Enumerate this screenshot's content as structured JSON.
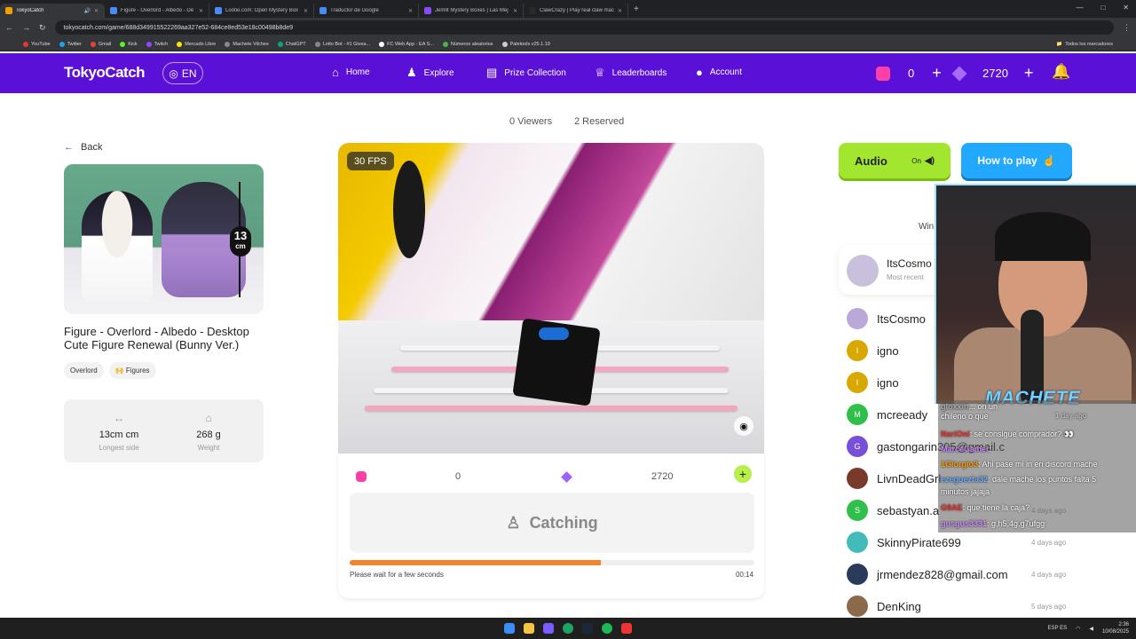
{
  "browser": {
    "tabs": [
      {
        "title": "TokyoCatch",
        "active": true
      },
      {
        "title": "Figure - Overlord - Albedo - De"
      },
      {
        "title": "Lootie.com: Open Mystery Box"
      },
      {
        "title": "Traductor de Google"
      },
      {
        "title": "Jemlit Mystery Boxes | Las Mej"
      },
      {
        "title": "ClawCrazy | Play real claw mac"
      }
    ],
    "url": "tokyocatch.com/game/688d349915522269aa327e52-684ce8ed53e18c00498b8de9",
    "bookmarks": [
      "YouTube",
      "Twitter",
      "Gmail",
      "Kick",
      "Twitch",
      "Mercado Libre",
      "Machete Vilches",
      "ChatGPT",
      "Lotto Bot - #1 Givea...",
      "FC Web App - EA S...",
      "Números aleatorios",
      "Paletools v25.1.19"
    ],
    "bookmarks_right": "Todos los marcadores"
  },
  "header": {
    "logo": "TokyoCatch",
    "lang": "EN",
    "nav": [
      {
        "label": "Home",
        "icon": "home-icon"
      },
      {
        "label": "Explore",
        "icon": "explore-icon"
      },
      {
        "label": "Prize Collection",
        "icon": "prize-collection-icon"
      },
      {
        "label": "Leaderboards",
        "icon": "leaderboard-icon"
      },
      {
        "label": "Account",
        "icon": "account-icon"
      }
    ],
    "tickets": "0",
    "points": "2720"
  },
  "stats": {
    "viewers": "0 Viewers",
    "reserved": "2 Reserved"
  },
  "product": {
    "back_label": "Back",
    "size_tag": "13",
    "size_unit": "cm",
    "title": "Figure - Overlord - Albedo - Desktop Cute Figure Renewal (Bunny Ver.)",
    "tags": [
      "Overlord",
      "🙌 Figures"
    ],
    "specs": [
      {
        "value": "13cm cm",
        "label": "Longest side"
      },
      {
        "value": "268 g",
        "label": "Weight"
      }
    ]
  },
  "game": {
    "fps": "30 FPS",
    "tickets": "0",
    "points": "2720",
    "catch_label": "Catching",
    "progress": 0.62,
    "wait_text": "Please wait for a few seconds",
    "timer": "00:14"
  },
  "right": {
    "audio_label": "Audio",
    "audio_state": "On",
    "howto_label": "How to play",
    "winners_label": "Win",
    "recent": {
      "name": "ItsCosmo",
      "sub": "Most recent"
    },
    "winners": [
      {
        "name": "ItsCosmo",
        "ago": "",
        "initial": "",
        "color": "#b9a8d8"
      },
      {
        "name": "igno",
        "ago": "",
        "initial": "I",
        "color": "#d8a800"
      },
      {
        "name": "igno",
        "ago": "",
        "initial": "I",
        "color": "#d8a800"
      },
      {
        "name": "mcreeady",
        "ago": "",
        "initial": "M",
        "color": "#2fbf4a"
      },
      {
        "name": "gastongarin305@gmail.c",
        "ago": "",
        "initial": "G",
        "color": "#7a4fd8"
      },
      {
        "name": "LivnDeadGrl",
        "ago": "",
        "initial": "",
        "color": "#7a3a2a"
      },
      {
        "name": "sebastyan.a",
        "ago": "4 days ago",
        "initial": "S",
        "color": "#2fbf4a"
      },
      {
        "name": "SkinnyPirate699",
        "ago": "4 days ago",
        "initial": "",
        "color": "#4bb"
      },
      {
        "name": "jrmendez828@gmail.com",
        "ago": "4 days ago",
        "initial": "",
        "color": "#2a3a5a"
      },
      {
        "name": "DenKing",
        "ago": "5 days ago",
        "initial": "",
        "color": "#8a6a4a"
      }
    ]
  },
  "stream": {
    "name": "MACHETE",
    "chat": [
      {
        "user": "gloxxin",
        "text": "... on un",
        "color": "#aaa"
      },
      {
        "user": "",
        "text": "chileno o que",
        "color": "#fff"
      },
      {
        "user": "NariOnl",
        "text": ": se consigue comprador? 👀",
        "color": "#e33"
      },
      {
        "user": "MarceGamer",
        "text": ":",
        "color": "#c8f"
      },
      {
        "user": "1Giorgio3",
        "text": ": Ahi pase mi in en discord mache",
        "color": "#f90"
      },
      {
        "user": "ezeguezta32",
        "text": ": dale mache los puntos falta 5",
        "color": "#6af"
      },
      {
        "user": "",
        "text": "minutos jajaja",
        "color": "#fff"
      },
      {
        "user": "G9AE",
        "text": ": que tiene la caja?",
        "color": "#e33"
      },
      {
        "user": "gusgus3331",
        "text": ": g,h5,4g,g7ufgg",
        "color": "#c8f"
      }
    ],
    "chat_time": "1 day ago"
  },
  "taskbar": {
    "lang": "ESP",
    "lang2": "ES",
    "time": "2:36",
    "date": "10/08/2025"
  }
}
